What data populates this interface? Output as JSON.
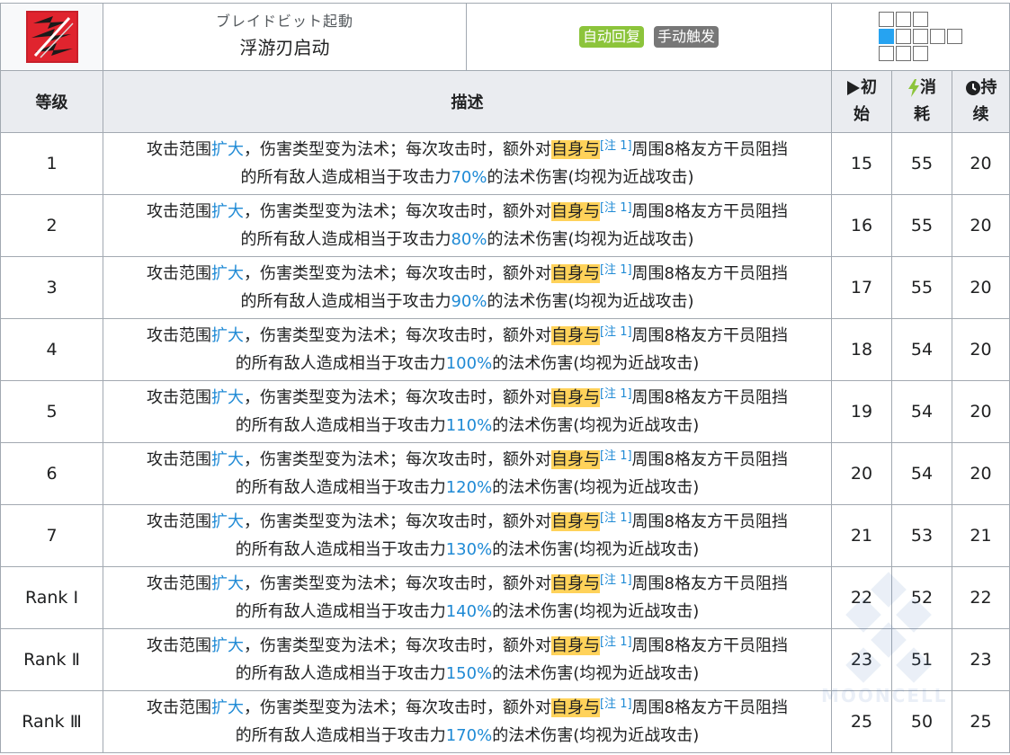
{
  "skill": {
    "icon": "skill-icon-blades",
    "name_jp": "ブレイドビット起動",
    "name_cn": "浮游刃启动",
    "recovery_type": "自动回复",
    "trigger_type": "手动触发",
    "range_icon": "attack-range-grid"
  },
  "colors": {
    "highlight_blue": "#1f8ad5",
    "highlight_yellow": "#ffd25a",
    "badge_green": "#8cc43b",
    "badge_gray": "#777777",
    "range_self": "#26a3f1"
  },
  "headers": {
    "level": "等级",
    "description": "描述",
    "initial_a": "初",
    "initial_b": "始",
    "cost_a": "消",
    "cost_b": "耗",
    "duration_a": "持",
    "duration_b": "续",
    "initial_icon": "play-icon",
    "cost_icon": "lightning-icon",
    "duration_icon": "clock-icon"
  },
  "desc_parts": {
    "p1": "攻击范围",
    "p2": "扩大",
    "p3": "，伤害类型变为法术；每次攻击时，额外对",
    "p4": "自身与",
    "note": "[注 1]",
    "p5": "周围8格友方干员阻挡",
    "p6": "的所有敌人造成相当于攻击力",
    "p7": "的法术伤害(均视为近战攻击)"
  },
  "rows": [
    {
      "level": "1",
      "pct": "70%",
      "initial": "15",
      "cost": "55",
      "duration": "20"
    },
    {
      "level": "2",
      "pct": "80%",
      "initial": "16",
      "cost": "55",
      "duration": "20"
    },
    {
      "level": "3",
      "pct": "90%",
      "initial": "17",
      "cost": "55",
      "duration": "20"
    },
    {
      "level": "4",
      "pct": "100%",
      "initial": "18",
      "cost": "54",
      "duration": "20"
    },
    {
      "level": "5",
      "pct": "110%",
      "initial": "19",
      "cost": "54",
      "duration": "20"
    },
    {
      "level": "6",
      "pct": "120%",
      "initial": "20",
      "cost": "54",
      "duration": "20"
    },
    {
      "level": "7",
      "pct": "130%",
      "initial": "21",
      "cost": "53",
      "duration": "21"
    },
    {
      "level": "Rank Ⅰ",
      "pct": "140%",
      "initial": "22",
      "cost": "52",
      "duration": "22"
    },
    {
      "level": "Rank Ⅱ",
      "pct": "150%",
      "initial": "23",
      "cost": "51",
      "duration": "23"
    },
    {
      "level": "Rank Ⅲ",
      "pct": "170%",
      "initial": "25",
      "cost": "50",
      "duration": "25"
    }
  ],
  "watermark": {
    "text": "MOONCELL"
  }
}
